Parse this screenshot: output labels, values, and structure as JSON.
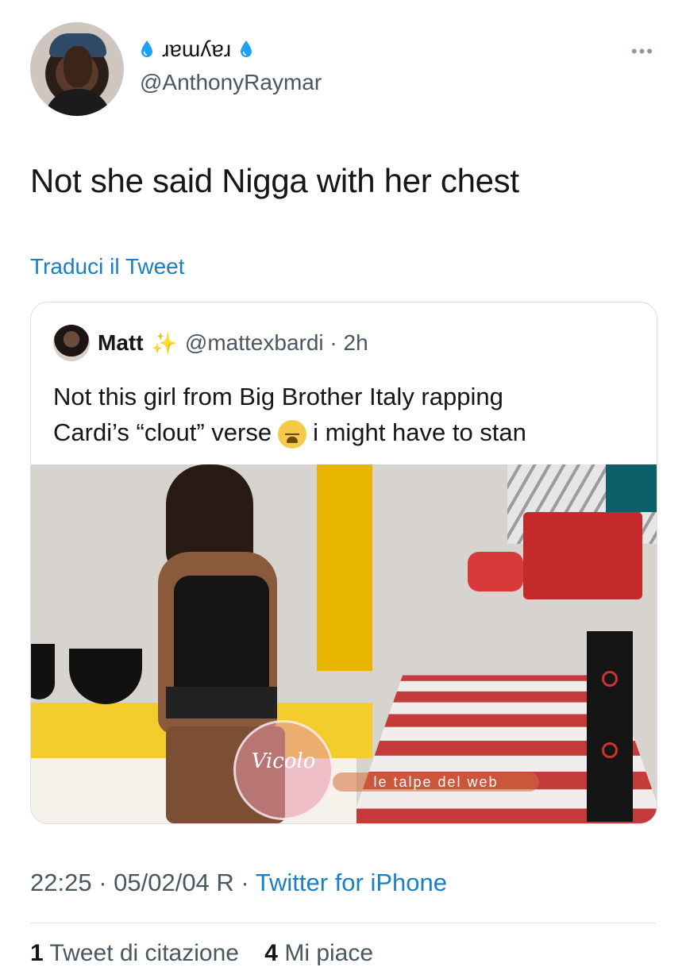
{
  "author": {
    "display_name": "ɹɐɯʎɐɹ",
    "handle": "@AnthonyRaymar",
    "more_label": "•••"
  },
  "tweet": {
    "text": "Not she said Nigga with her chest",
    "translate_label": "Traduci il Tweet"
  },
  "quoted": {
    "name": "Matt",
    "sparkle": "✨",
    "handle_time": "@mattexbardi · 2h",
    "text_line1": "Not this girl from Big Brother Italy rapping",
    "text_line2a": "Cardi’s “clout” verse",
    "text_line2b": "i might have to stan"
  },
  "watermarks": {
    "circle_text": "Vicolo",
    "banner_text": "le talpe del web"
  },
  "footer": {
    "time_date": "22:25 · 05/02/04 R · ",
    "source": "Twitter for iPhone"
  },
  "stats": {
    "retweets_count": "1",
    "retweets_label": "Tweet di citazione",
    "likes_count": "4",
    "likes_label": "Mi piace"
  },
  "colors": {
    "link": "#1b7fc4",
    "drop": "#1da1f2"
  }
}
